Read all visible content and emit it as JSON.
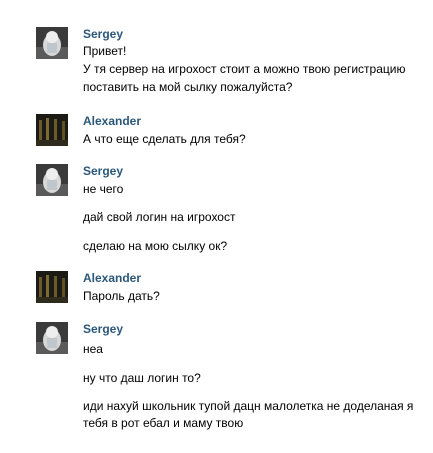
{
  "messages": [
    {
      "author": "Sergey",
      "avatar_icon": "sergey-avatar-photo",
      "lines": [
        "Привет!",
        "У тя сервер на игрохост стоит а можно твою регистрацию",
        "поставить на мой сылку пожалуйста?"
      ]
    },
    {
      "author": "Alexander",
      "avatar_icon": "alexander-avatar-photo",
      "lines": [
        "А что еще сделать для тебя?"
      ]
    },
    {
      "author": "Sergey",
      "avatar_icon": "sergey-avatar-photo",
      "lines": [
        "не чего",
        "дай свой логин на игрохост",
        "сделаю на мою сылку ок?"
      ]
    },
    {
      "author": "Alexander",
      "avatar_icon": "alexander-avatar-photo",
      "lines": [
        "Пароль дать?"
      ]
    },
    {
      "author": "Sergey",
      "avatar_icon": "sergey-avatar-photo",
      "lines": [
        "неа",
        "ну что даш логин то?",
        "иди нахуй школьник тупой дацн малолетка не доделаная я",
        "тебя в рот ебал и маму твою"
      ]
    }
  ],
  "colors": {
    "author": "#2b587a",
    "text": "#000000",
    "background": "#ffffff"
  }
}
